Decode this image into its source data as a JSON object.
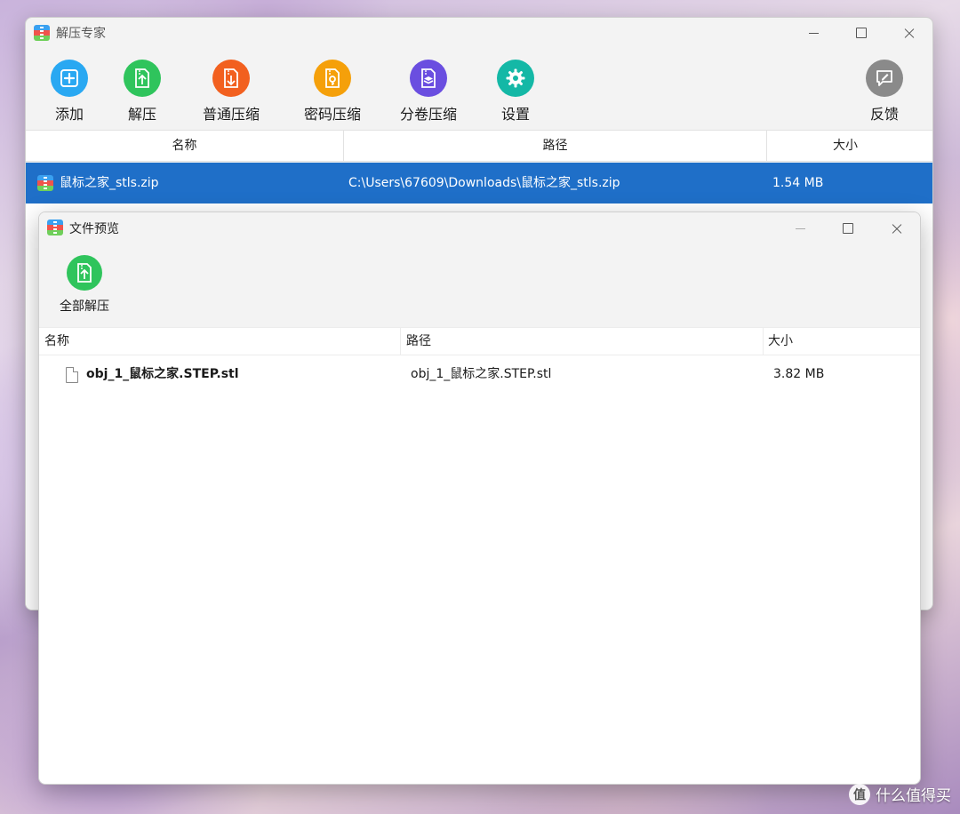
{
  "main_window": {
    "title": "解压专家",
    "toolbar": [
      {
        "label": "添加",
        "icon": "add-icon",
        "color": "#29a8f2"
      },
      {
        "label": "解压",
        "icon": "extract-icon",
        "color": "#2fc45c"
      },
      {
        "label": "普通压缩",
        "icon": "compress-icon",
        "color": "#f2601f"
      },
      {
        "label": "密码压缩",
        "icon": "password-compress-icon",
        "color": "#f5a00a"
      },
      {
        "label": "分卷压缩",
        "icon": "split-compress-icon",
        "color": "#6a4ee0"
      },
      {
        "label": "设置",
        "icon": "gear-icon",
        "color": "#14b8a6"
      },
      {
        "label": "反馈",
        "icon": "feedback-icon",
        "color": "#8a8a8a"
      }
    ],
    "columns": [
      "名称",
      "路径",
      "大小"
    ],
    "rows": [
      {
        "name": "鼠标之家_stls.zip",
        "path": "C:\\Users\\67609\\Downloads\\鼠标之家_stls.zip",
        "size": "1.54 MB"
      }
    ],
    "selected_row_color": "#1f6fc8"
  },
  "preview_window": {
    "title": "文件预览",
    "toolbar": [
      {
        "label": "全部解压",
        "icon": "extract-all-icon",
        "color": "#2fc45c"
      }
    ],
    "columns": [
      "名称",
      "路径",
      "大小"
    ],
    "rows": [
      {
        "name": "obj_1_鼠标之家.STEP.stl",
        "path": "obj_1_鼠标之家.STEP.stl",
        "size": "3.82 MB",
        "icon": "file-icon"
      }
    ]
  },
  "watermark": {
    "text": "什么值得买"
  }
}
